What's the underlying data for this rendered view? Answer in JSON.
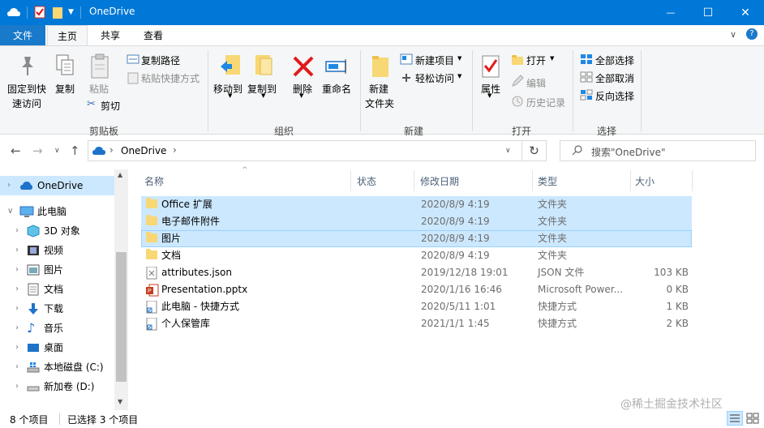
{
  "window": {
    "title": "OneDrive",
    "controls": {
      "minimize": "—",
      "maximize": "☐",
      "close": "✕"
    }
  },
  "ribbon_tabs": [
    {
      "label": "文件"
    },
    {
      "label": "主页"
    },
    {
      "label": "共享"
    },
    {
      "label": "查看"
    }
  ],
  "ribbon": {
    "clipboard": {
      "pin_top": "固定到快",
      "pin_bottom": "速访问",
      "copy": "复制",
      "paste": "粘贴",
      "copy_path": "复制路径",
      "paste_shortcut": "粘贴快捷方式",
      "cut": "剪切",
      "group": "剪贴板"
    },
    "organize": {
      "move_to": "移动到",
      "copy_to": "复制到",
      "delete": "删除",
      "rename": "重命名",
      "group": "组织"
    },
    "new": {
      "new_folder_top": "新建",
      "new_folder_bottom": "文件夹",
      "new_item": "新建项目",
      "easy_access": "轻松访问",
      "group": "新建"
    },
    "open": {
      "properties": "属性",
      "open": "打开",
      "edit": "编辑",
      "history": "历史记录",
      "group": "打开"
    },
    "select": {
      "select_all": "全部选择",
      "select_none": "全部取消",
      "invert": "反向选择",
      "group": "选择"
    }
  },
  "address": {
    "location": "OneDrive",
    "separator": "›",
    "search_placeholder": "搜索\"OneDrive\""
  },
  "nav": [
    {
      "label": "OneDrive",
      "selected": true
    },
    {
      "label": "此电脑"
    },
    {
      "label": "3D 对象"
    },
    {
      "label": "视频"
    },
    {
      "label": "图片"
    },
    {
      "label": "文档"
    },
    {
      "label": "下载"
    },
    {
      "label": "音乐"
    },
    {
      "label": "桌面"
    },
    {
      "label": "本地磁盘 (C:)"
    },
    {
      "label": "新加卷 (D:)"
    }
  ],
  "columns": {
    "name": "名称",
    "status": "状态",
    "modified": "修改日期",
    "type": "类型",
    "size": "大小"
  },
  "files": [
    {
      "name": "Office 扩展",
      "modified": "2020/8/9 4:19",
      "type": "文件夹",
      "size": "",
      "icon": "folder",
      "selected": true
    },
    {
      "name": "电子邮件附件",
      "modified": "2020/8/9 4:19",
      "type": "文件夹",
      "size": "",
      "icon": "folder",
      "selected": true
    },
    {
      "name": "图片",
      "modified": "2020/8/9 4:19",
      "type": "文件夹",
      "size": "",
      "icon": "folder",
      "selected": true
    },
    {
      "name": "文档",
      "modified": "2020/8/9 4:19",
      "type": "文件夹",
      "size": "",
      "icon": "folder"
    },
    {
      "name": "attributes.json",
      "modified": "2019/12/18 19:01",
      "type": "JSON 文件",
      "size": "103 KB",
      "icon": "json"
    },
    {
      "name": "Presentation.pptx",
      "modified": "2020/1/16 16:46",
      "type": "Microsoft Power...",
      "size": "0 KB",
      "icon": "pptx"
    },
    {
      "name": "此电脑 - 快捷方式",
      "modified": "2020/5/11 1:01",
      "type": "快捷方式",
      "size": "1 KB",
      "icon": "shortcut"
    },
    {
      "name": "个人保管库",
      "modified": "2021/1/1 1:45",
      "type": "快捷方式",
      "size": "2 KB",
      "icon": "shortcut"
    }
  ],
  "status": {
    "count": "8 个项目",
    "selected": "已选择 3 个项目"
  },
  "watermark": "@稀土掘金技术社区",
  "colors": {
    "titlebar": "#0078d7",
    "selection": "#cce8ff",
    "ribbon_bg": "#f5f6f7"
  }
}
